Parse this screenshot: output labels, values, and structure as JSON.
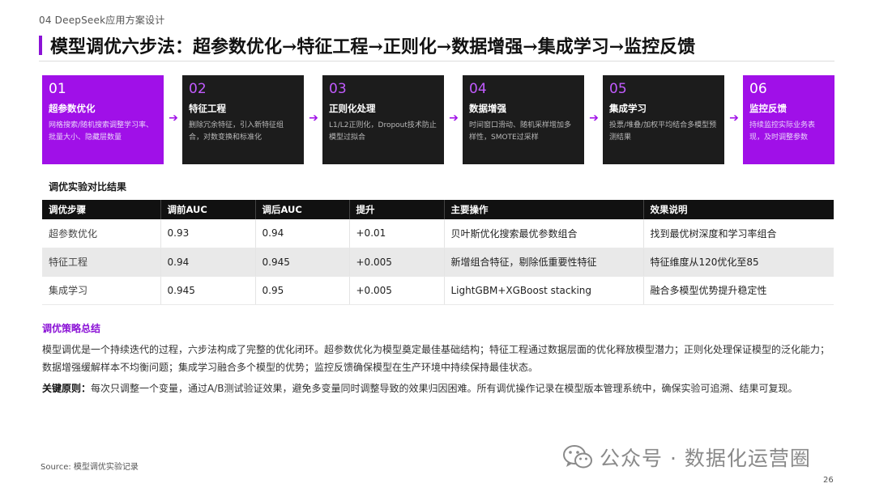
{
  "header": {
    "section_label": "04 DeepSeek应用方案设计",
    "title": "模型调优六步法：超参数优化→特征工程→正则化→数据增强→集成学习→监控反馈"
  },
  "steps": [
    {
      "num": "01",
      "title": "超参数优化",
      "desc": "网格搜索/随机搜索调整学习率、批量大小、隐藏层数量",
      "accent": true
    },
    {
      "num": "02",
      "title": "特征工程",
      "desc": "删除冗余特征，引入新特征组合，对数变换和标准化",
      "accent": false
    },
    {
      "num": "03",
      "title": "正则化处理",
      "desc": "L1/L2正则化，Dropout技术防止模型过拟合",
      "accent": false
    },
    {
      "num": "04",
      "title": "数据增强",
      "desc": "时间窗口滑动、随机采样增加多样性，SMOTE过采样",
      "accent": false
    },
    {
      "num": "05",
      "title": "集成学习",
      "desc": "投票/堆叠/加权平均结合多模型预测结果",
      "accent": false
    },
    {
      "num": "06",
      "title": "监控反馈",
      "desc": "持续监控实际业务表现，及时调整参数",
      "accent": true
    }
  ],
  "arrow_glyph": "➔",
  "results": {
    "heading": "调优实验对比结果",
    "columns": [
      "调优步骤",
      "调前AUC",
      "调后AUC",
      "提升",
      "主要操作",
      "效果说明"
    ],
    "rows": [
      [
        "超参数优化",
        "0.93",
        "0.94",
        "+0.01",
        "贝叶斯优化搜索最优参数组合",
        "找到最优树深度和学习率组合"
      ],
      [
        "特征工程",
        "0.94",
        "0.945",
        "+0.005",
        "新增组合特征，剔除低重要性特征",
        "特征维度从120优化至85"
      ],
      [
        "集成学习",
        "0.945",
        "0.95",
        "+0.005",
        "LightGBM+XGBoost stacking",
        "融合多模型优势提升稳定性"
      ]
    ]
  },
  "strategy": {
    "heading": "调优策略总结",
    "summary": "模型调优是一个持续迭代的过程，六步法构成了完整的优化闭环。超参数优化为模型奠定最佳基础结构；特征工程通过数据层面的优化释放模型潜力；正则化处理保证模型的泛化能力；数据增强缓解样本不均衡问题；集成学习融合多个模型的优势；监控反馈确保模型在生产环境中持续保持最佳状态。",
    "principle_label": "关键原则：",
    "principle_text": "每次只调整一个变量，通过A/B测试验证效果，避免多变量同时调整导致的效果归因困难。所有调优操作记录在模型版本管理系统中，确保实验可追溯、结果可复现。"
  },
  "footer": {
    "source": "Source: 模型调优实验记录",
    "page_number": "26",
    "watermark": "公众号 · 数据化运营圈"
  },
  "colors": {
    "accent": "#a010e8",
    "dark_card": "#1c1c1c",
    "table_header": "#111111"
  }
}
